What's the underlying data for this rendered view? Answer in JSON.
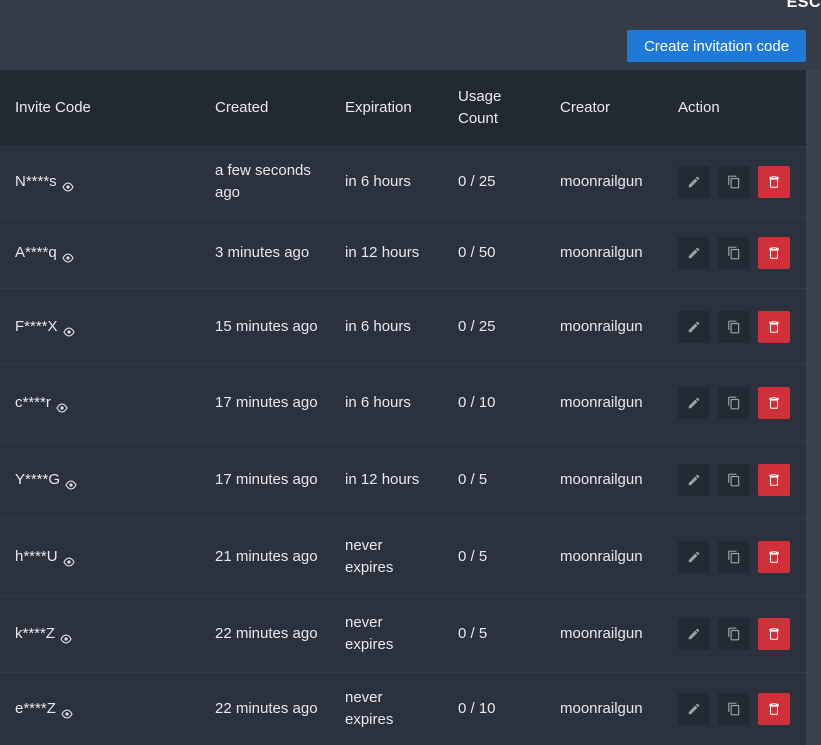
{
  "header": {
    "corner_label": "ESC",
    "create_button_label": "Create invitation code"
  },
  "table": {
    "columns": {
      "invite_code": "Invite Code",
      "created": "Created",
      "expiration": "Expiration",
      "usage_count_line1": "Usage",
      "usage_count_line2": "Count",
      "creator": "Creator",
      "action": "Action"
    },
    "rows": [
      {
        "code": "N****s",
        "created": "a few seconds ago",
        "expiration": "in 6 hours",
        "usage": "0 / 25",
        "creator": "moonrailgun"
      },
      {
        "code": "A****q",
        "created": "3 minutes ago",
        "expiration": "in 12 hours",
        "usage": "0 / 50",
        "creator": "moonrailgun"
      },
      {
        "code": "F****X",
        "created": "15 minutes ago",
        "expiration": "in 6 hours",
        "usage": "0 / 25",
        "creator": "moonrailgun"
      },
      {
        "code": "c****r",
        "created": "17 minutes ago",
        "expiration": "in 6 hours",
        "usage": "0 / 10",
        "creator": "moonrailgun"
      },
      {
        "code": "Y****G",
        "created": "17 minutes ago",
        "expiration": "in 12 hours",
        "usage": "0 / 5",
        "creator": "moonrailgun"
      },
      {
        "code": "h****U",
        "created": "21 minutes ago",
        "expiration": "never expires",
        "usage": "0 / 5",
        "creator": "moonrailgun"
      },
      {
        "code": "k****Z",
        "created": "22 minutes ago",
        "expiration": "never expires",
        "usage": "0 / 5",
        "creator": "moonrailgun"
      },
      {
        "code": "e****Z",
        "created": "22 minutes ago",
        "expiration": "never expires",
        "usage": "0 / 10",
        "creator": "moonrailgun"
      }
    ]
  },
  "icons": {
    "reveal": "eye-icon",
    "edit": "pencil-icon",
    "copy": "copy-icon",
    "delete": "trash-icon"
  },
  "colors": {
    "primary": "#1e7ad6",
    "danger": "#d0303a",
    "header_bg": "#232932",
    "body_bg": "#2b313d"
  }
}
